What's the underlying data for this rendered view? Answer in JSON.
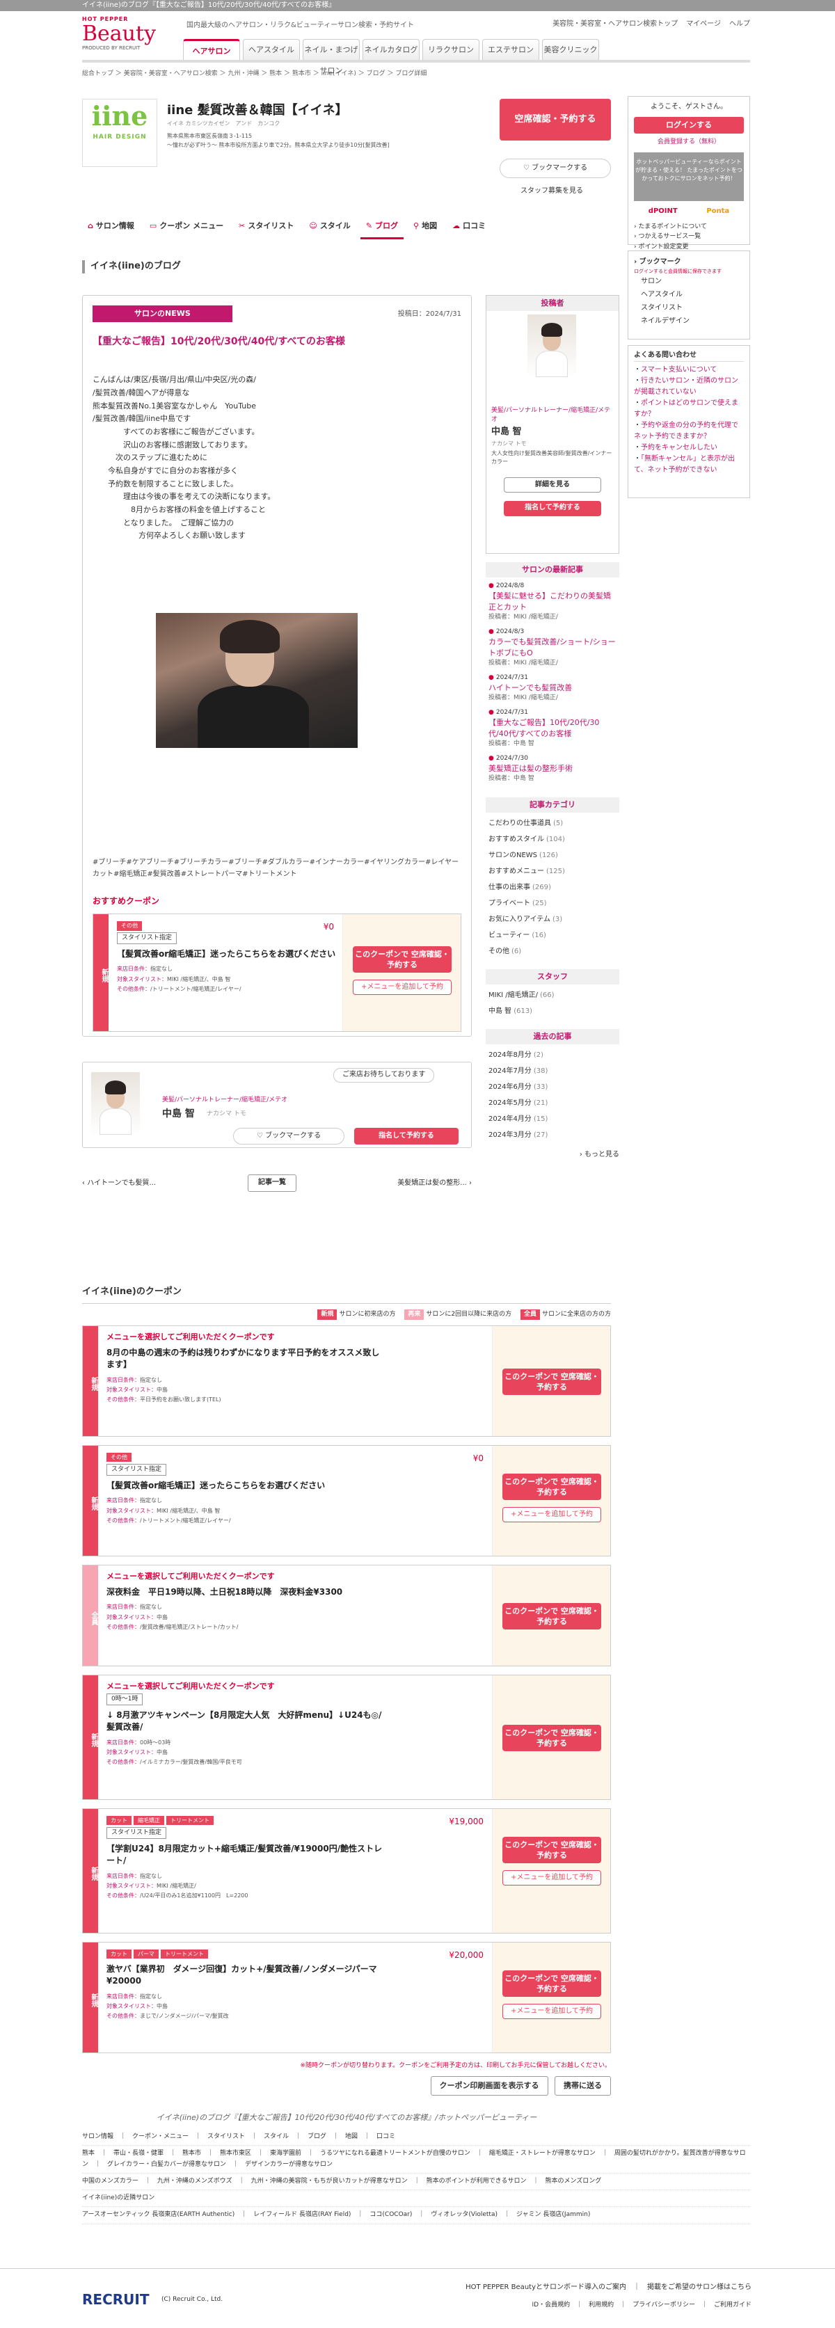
{
  "topbar": "イイネ(iine)のブログ『【重大なご報告】10代/20代/30代/40代/すべてのお客様』",
  "brand": {
    "hp": "HOT PEPPER",
    "beauty": "Beauty",
    "powered": "PRODUCED BY RECRUIT"
  },
  "header": {
    "desc": "国内最大級のヘアサロン・リラク&ビューティーサロン検索・予約サイト",
    "links": [
      "美容院・美容室・ヘアサロン検索トップ",
      "マイページ",
      "ヘルプ"
    ]
  },
  "tabs": [
    "ヘアサロン",
    "ヘアスタイル",
    "ネイル・まつげサロン",
    "ネイルカタログ",
    "リラクサロン",
    "エステサロン",
    "美容クリニック"
  ],
  "breadcrumb": "総合トップ ＞ 美容院・美容室・ヘアサロン検索 ＞ 九州・沖縄 ＞ 熊本 ＞ 熊本市 ＞ iine(イイネ) ＞ ブログ ＞ ブログ詳細",
  "salon": {
    "logo1": "iine",
    "logo2": "HAIR DESIGN",
    "name": "iine 髪質改善＆韓国【イイネ】",
    "kana": "イイネ  カミシツカイゼン　アンド　カンコク",
    "addr1": "熊本県熊本市東区長嶺南３-1-115",
    "addr2": "〜憧れが必ず叶う〜 熊本市役所方面より車で2分。熊本県立大学より徒歩10分[髪質改善]",
    "reserve": "空席確認・予約する",
    "bookmark": "ブックマークする",
    "staffrec": "スタッフ募集を見る"
  },
  "salontabs": [
    "サロン情報",
    "クーポン メニュー",
    "スタイリスト",
    "スタイル",
    "ブログ",
    "地図",
    "口コミ"
  ],
  "section_title": "イイネ(iine)のブログ",
  "blog": {
    "badge": "サロンのNEWS",
    "date": "投稿日：2024/7/31",
    "title": "【重大なご報告】10代/20代/30代/40代/すべてのお客様",
    "body": "こんばんは/東区/長嶺/月出/県山/中央区/光の森/\n/髪質改善/韓国ヘアが得意な\n熊本髪質改善No.1美容室なかしゃん　YouTube\n/髪質改善/韓国/iine中島です\n　　　　すべてのお客様にご報告がございます。\n　　　　沢山のお客様に感謝致しております。\n　　　次のステップに進むために\n　　今私自身がすでに自分のお客様が多く\n　　予約数を制限することに致しました。\n　　　　理由は今後の事を考えての決断になります。\n　　　　　8月からお客様の料金を値上げすること\n　　　　となりました。　ご理解ご協力の\n　　　　　　方何卒よろしくお願い致します",
    "tags": "#ブリーチ#ケアブリーチ#ブリーチカラー#ブリーチ#ダブルカラー#インナーカラー#イヤリングカラー#レイヤーカット#縮毛矯正#髪質改善#ストレートパーマ#トリートメント"
  },
  "rec_coupon": {
    "title": "おすすめクーポン",
    "side": "新規",
    "tag": "その他",
    "staff": "スタイリスト指定",
    "name": "【髪質改善or縮毛矯正】迷ったらこちらをお選びください",
    "price": "¥0",
    "m1l": "来店日条件：",
    "m1v": "指定なし",
    "m2l": "対象スタイリスト：",
    "m2v": "MIKI /縮毛矯正/、中島 智",
    "m3l": "その他条件：",
    "m3v": "/トリートメント/縮毛矯正/レイヤー/",
    "btn": "このクーポンで 空席確認・予約する",
    "add": "+メニューを追加して予約"
  },
  "stylist": {
    "title": "美髪/パーソナルトレーナー/縮毛矯正/メテオ",
    "name": "中島 智",
    "kana": "ナカシマ トモ",
    "bubble": "ご来店お待ちしております",
    "bm": "ブックマークする",
    "reserve": "指名して予約する"
  },
  "pager": {
    "prev": "ハイトーンでも髪質...",
    "list": "記事一覧",
    "next": "美髪矯正は髪の整形..."
  },
  "poster": {
    "head": "投稿者",
    "title": "美髪/パーソナルトレーナー/縮毛矯正/メテオ",
    "name": "中島 智",
    "kana": "ナカシマ トモ",
    "desc": "大人女性向け髪質改善美容師/髪質改善/インナーカラー",
    "detail": "詳細を見る",
    "reserve": "指名して予約する"
  },
  "latest": {
    "head": "サロンの最新記事",
    "items": [
      {
        "d": "2024/8/8",
        "t": "【美髪に魅せる】こだわりの美髪矯正とカット",
        "by": "投稿者：MIKI /縮毛矯正/"
      },
      {
        "d": "2024/8/3",
        "t": "カラーでも髪質改善/ショート/ショートボブにもO",
        "by": "投稿者：MIKI /縮毛矯正/"
      },
      {
        "d": "2024/7/31",
        "t": "ハイトーンでも髪質改善",
        "by": "投稿者：MIKI /縮毛矯正/"
      },
      {
        "d": "2024/7/31",
        "t": "【重大なご報告】10代/20代/30代/40代/すべてのお客様",
        "by": "投稿者：中島 智"
      },
      {
        "d": "2024/7/30",
        "t": "美髪矯正は髪の整形手術",
        "by": "投稿者：中島 智"
      }
    ]
  },
  "categories": {
    "head": "記事カテゴリ",
    "items": [
      {
        "n": "こだわりの仕事道具",
        "c": "(5)"
      },
      {
        "n": "おすすめスタイル",
        "c": "(104)"
      },
      {
        "n": "サロンのNEWS",
        "c": "(126)"
      },
      {
        "n": "おすすめメニュー",
        "c": "(125)"
      },
      {
        "n": "仕事の出来事",
        "c": "(269)"
      },
      {
        "n": "プライベート",
        "c": "(25)"
      },
      {
        "n": "お気に入りアイテム",
        "c": "(3)"
      },
      {
        "n": "ビューティー",
        "c": "(16)"
      },
      {
        "n": "その他",
        "c": "(6)"
      }
    ]
  },
  "staffbox": {
    "head": "スタッフ",
    "items": [
      {
        "n": "MIKI /縮毛矯正/",
        "c": "(66)"
      },
      {
        "n": "中島 智",
        "c": "(613)"
      }
    ]
  },
  "archive": {
    "head": "過去の記事",
    "items": [
      {
        "n": "2024年8月分",
        "c": "(2)"
      },
      {
        "n": "2024年7月分",
        "c": "(38)"
      },
      {
        "n": "2024年6月分",
        "c": "(33)"
      },
      {
        "n": "2024年5月分",
        "c": "(21)"
      },
      {
        "n": "2024年4月分",
        "c": "(15)"
      },
      {
        "n": "2024年3月分",
        "c": "(27)"
      }
    ],
    "more": "もっと見る"
  },
  "login": {
    "welcome": "ようこそ、ゲストさん。",
    "login": "ログインする",
    "register": "会員登録する（無料）",
    "promo": "ホットペッパービューティーならポイントが貯まる・使える！ たまったポイントをつかっておトクにサロンをネット予約！",
    "dpoint": "dPOINT",
    "ponta": "Ponta",
    "links": [
      "たまるポイントについて",
      "つかえるサービス一覧",
      "ポイント設定変更"
    ]
  },
  "bmbox": {
    "head": "ブックマーク",
    "note": "ログインすると会員情報に保存できます",
    "items": [
      "サロン",
      "ヘアスタイル",
      "スタイリスト",
      "ネイルデザイン"
    ]
  },
  "faq": {
    "head": "よくある問い合わせ",
    "items": [
      "スマート支払いについて",
      "行きたいサロン・近隣のサロンが掲載されていない",
      "ポイントはどのサロンで使えますか？",
      "予約や返金の分の予約を代理でネット予約できますか？",
      "予約をキャンセルしたい",
      "「無断キャンセル」と表示が出て、ネット予約ができない"
    ]
  },
  "couponlist": {
    "title": "イイネ(iine)のクーポン",
    "legend": [
      {
        "k": "新規",
        "t": "サロンに初来店の方",
        "c": "#e8455c"
      },
      {
        "k": "再来",
        "t": "サロンに2回目以降に来店の方",
        "c": "#f7a4b3"
      },
      {
        "k": "全員",
        "t": "サロンに全来店の方の方",
        "c": "#e8455c"
      }
    ],
    "items": [
      {
        "side": "新規",
        "choose": "メニューを選択してご利用いただくクーポンです",
        "name": "8月の中島の週末の予約は残りわずかになります平日予約をオススメ致します】",
        "m1": "指定なし",
        "m2": "中島",
        "m3": "平日予約をお願い致します(TEL)",
        "price": "",
        "tags": [],
        "staff": ""
      },
      {
        "side": "新規",
        "choose": "",
        "name": "【髪質改善or縮毛矯正】迷ったらこちらをお選びください",
        "m1": "指定なし",
        "m2": "MIKI /縮毛矯正/、中島 智",
        "m3": "/トリートメント/縮毛矯正/レイヤー/",
        "price": "¥0",
        "tags": [
          "その他"
        ],
        "staff": "スタイリスト指定"
      },
      {
        "side": "全員",
        "choose": "メニューを選択してご利用いただくクーポンです",
        "name": "深夜料金　平日19時以降、土日祝18時以降　深夜料金¥3300",
        "m1": "指定なし",
        "m2": "中島",
        "m3": "/髪質改善/縮毛矯正/ストレート/カット/",
        "price": "",
        "tags": [],
        "staff": ""
      },
      {
        "side": "新規",
        "choose": "メニューを選択してご利用いただくクーポンです",
        "name": "↓ 8月激アツキャンペーン【8月限定大人気　大好評menu】↓U24も◎/髪質改善/",
        "m1": "00時〜03時",
        "m2": "中島",
        "m3": "/イルミナカラー/髪質改善/韓国/平良モ可",
        "price": "",
        "tags": [],
        "staff": "0時〜1時"
      },
      {
        "side": "新規",
        "choose": "",
        "name": "【学割U24】8月限定カット+縮毛矯正/髪質改善/¥19000円/艶性ストレート/",
        "m1": "指定なし",
        "m2": "MIKI /縮毛矯正/",
        "m3": "/U24/平日のみ1名追加¥1100円　L=2200",
        "price": "¥19,000",
        "tags": [
          "カット",
          "縮毛矯正",
          "トリートメント"
        ],
        "staff": "スタイリスト指定"
      },
      {
        "side": "新規",
        "choose": "",
        "name": "激ヤバ【業界初　ダメージ回復】カット+/髪質改善/ノンダメージパーマ¥20000",
        "m1": "指定なし",
        "m2": "中島",
        "m3": "まじで/ノンダメージ/パーマ/髪質改",
        "price": "¥20,000",
        "tags": [
          "カット",
          "パーマ",
          "トリートメント"
        ],
        "staff": ""
      }
    ],
    "label_date": "来店日条件：",
    "label_staff": "対象スタイリスト：",
    "label_other": "その他条件：",
    "btn": "このクーポンで 空席確認・予約する",
    "add": "+メニューを追加して予約",
    "notice": "※随時クーポンが切り替わります。クーポンをご利用予定の方は、印刷してお手元に保管してお越しください。",
    "print": "クーポン印刷画面を表示する",
    "mobile": "携帯に送る"
  },
  "tagline": "イイネ(iine)のブログ『【重大なご報告】10代/20代/30代/40代/すべてのお客様』/ホットペッパービューティー",
  "footer": {
    "row1": "サロン情報　｜　クーポン・メニュー　｜　スタイリスト　｜　スタイル　｜　ブログ　｜　地図　｜　口コミ",
    "row2": "熊本　｜　帯山・長嶺・健軍　｜　熊本市　｜　熊本市東区　｜　東海学園前　｜　うるツヤになれる最適トリートメントが自慢のサロン　｜　縮毛矯正・ストレートが得意なサロン　｜　周囲の髪切れがかかり。髪質改善が得意なサロン　｜　グレイカラー・白髪カバーが得意なサロン　｜　デザインカラーが得意なサロン",
    "row3": "中国のメンズカラー　｜　九州・沖縄のメンズボウズ　｜　九州・沖縄の美容院・もちが良いカットが得意なサロン　｜　熊本のポイントが利用できるサロン　｜　熊本のメンズロング",
    "row4": "イイネ(iine)の近隣サロン",
    "row5": "アースオーセンティック 長嶺東店(EARTH Authentic)　｜　レイフィールド 長嶺店(RAY Field)　｜　ココ(COCOar)　｜　ヴィオレッタ(Violetta)　｜　ジャミン 長嶺店(Jammin)"
  },
  "bottom": {
    "recruit": "RECRUIT",
    "copy": "(C) Recruit Co., Ltd.",
    "links1": [
      "HOT PEPPER Beautyとサロンボード導入のご案内",
      "掲載をご希望のサロン様はこちら"
    ],
    "links2": [
      "ID・会員規約",
      "利用規約",
      "プライバシーポリシー",
      "ご利用ガイド"
    ]
  }
}
